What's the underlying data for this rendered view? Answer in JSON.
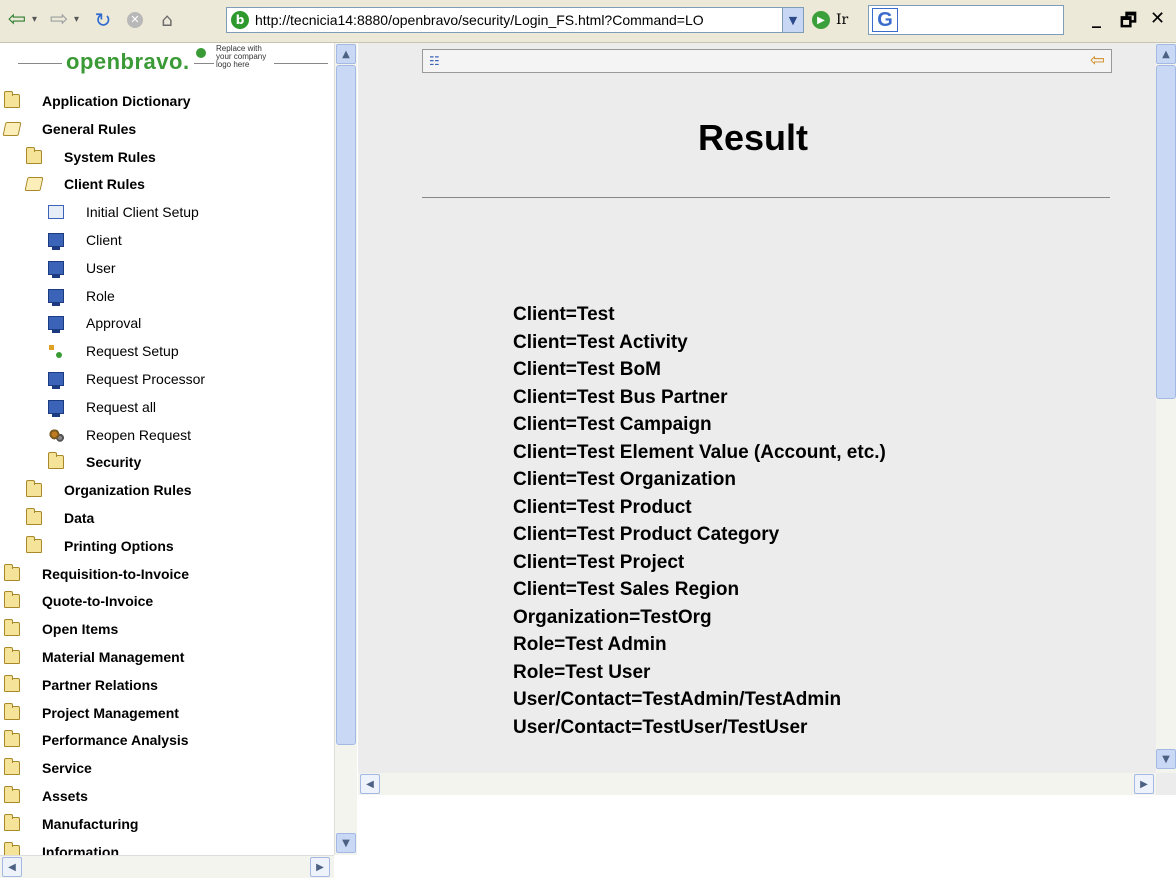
{
  "browser": {
    "url": "http://tecnicia14:8880/openbravo/security/Login_FS.html?Command=LO",
    "go_label": "Ir",
    "google_label": "G"
  },
  "logo": {
    "brand": "openbravo.",
    "placeholder": "Replace with your company logo here"
  },
  "menu": {
    "items": [
      {
        "label": "Application Dictionary",
        "icon": "folder-icon"
      },
      {
        "label": "General Rules",
        "icon": "folder-open-icon"
      },
      {
        "label": "System Rules",
        "icon": "folder-icon"
      },
      {
        "label": "Client Rules",
        "icon": "folder-open-icon"
      },
      {
        "label": "Initial Client Setup",
        "icon": "form-icon"
      },
      {
        "label": "Client",
        "icon": "window-icon"
      },
      {
        "label": "User",
        "icon": "window-icon"
      },
      {
        "label": "Role",
        "icon": "window-icon"
      },
      {
        "label": "Approval",
        "icon": "window-icon"
      },
      {
        "label": "Request Setup",
        "icon": "tree-icon"
      },
      {
        "label": "Request Processor",
        "icon": "window-icon"
      },
      {
        "label": "Request all",
        "icon": "window-icon"
      },
      {
        "label": "Reopen Request",
        "icon": "gear-icon"
      },
      {
        "label": "Security",
        "icon": "folder-icon"
      },
      {
        "label": "Organization Rules",
        "icon": "folder-icon"
      },
      {
        "label": "Data",
        "icon": "folder-icon"
      },
      {
        "label": "Printing Options",
        "icon": "folder-icon"
      },
      {
        "label": "Requisition-to-Invoice",
        "icon": "folder-icon"
      },
      {
        "label": "Quote-to-Invoice",
        "icon": "folder-icon"
      },
      {
        "label": "Open Items",
        "icon": "folder-icon"
      },
      {
        "label": "Material Management",
        "icon": "folder-icon"
      },
      {
        "label": "Partner Relations",
        "icon": "folder-icon"
      },
      {
        "label": "Project Management",
        "icon": "folder-icon"
      },
      {
        "label": "Performance Analysis",
        "icon": "folder-icon"
      },
      {
        "label": "Service",
        "icon": "folder-icon"
      },
      {
        "label": "Assets",
        "icon": "folder-icon"
      },
      {
        "label": "Manufacturing",
        "icon": "folder-icon"
      },
      {
        "label": "Information",
        "icon": "folder-icon"
      }
    ]
  },
  "content": {
    "title": "Result",
    "results": [
      "Client=Test",
      "Client=Test Activity",
      "Client=Test BoM",
      "Client=Test Bus Partner",
      "Client=Test Campaign",
      "Client=Test Element Value (Account, etc.)",
      "Client=Test Organization",
      "Client=Test Product",
      "Client=Test Product Category",
      "Client=Test Project",
      "Client=Test Sales Region",
      "Organization=TestOrg",
      "Role=Test Admin",
      "Role=Test User",
      "User/Contact=TestAdmin/TestAdmin",
      "User/Contact=TestUser/TestUser"
    ]
  },
  "colors": {
    "brand_green": "#3a9a35",
    "scrollbar": "#c9d8f5",
    "content_bg": "#ececec"
  }
}
